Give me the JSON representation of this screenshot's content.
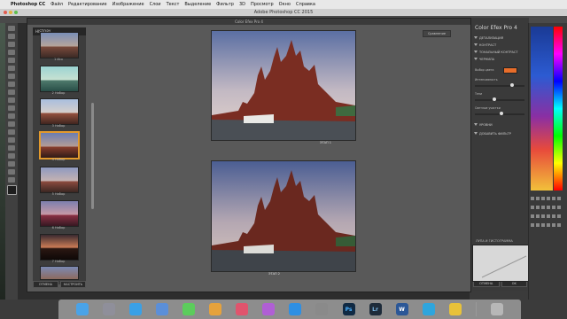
{
  "menubar": {
    "app_name": "Photoshop CC",
    "items": [
      "Файл",
      "Редактирование",
      "Изображение",
      "Слои",
      "Текст",
      "Выделение",
      "Фильтр",
      "3D",
      "Просмотр",
      "Окно",
      "Справка"
    ]
  },
  "window_title": "Adobe Photoshop CC 2015",
  "plugin_title": "Color Efex Pro 4",
  "filmstrip": {
    "header": "HISTORY",
    "captions": [
      "1 Исх",
      "2 Набор",
      "3 Набор",
      "4 Набор",
      "5 Набор",
      "6 Набор",
      "7 Набор",
      "8 Набор"
    ],
    "footer": {
      "left": "ОТМЕНА",
      "right": "НАСТРОИТЬ"
    }
  },
  "preview": {
    "top_button": "Сравнение",
    "top_caption": "ЭТАП 1",
    "bottom_caption": "ЭТАП 2"
  },
  "right_panel": {
    "title_main": "Color Efex Pro",
    "title_version": "4",
    "filter_items": [
      "ДЕТАЛИЗАЦИЯ",
      "КОНТРАСТ",
      "ТОНАЛЬНЫЙ КОНТРАСТ",
      "ЧЕРНИЛА"
    ],
    "controls": {
      "row1_label": "Выбор цвета",
      "row2_label": "Интенсивность",
      "row3_label": "Тени",
      "row4_label": "Светлые участки"
    },
    "sections": [
      "УРОВНИ",
      "ДОБАВИТЬ ФИЛЬТР"
    ],
    "bottom": {
      "ok": "OK",
      "cancel": "ОТМЕНА"
    },
    "loupe_title": "ЛУПА И ГИСТОГРАММА"
  },
  "dock": {
    "apps": [
      "Finder",
      "Launchpad",
      "Safari",
      "Mail",
      "Messages",
      "Photos",
      "Music",
      "iTunes",
      "App Store",
      "Settings",
      "Photoshop",
      "Lightroom",
      "Word",
      "Telegram",
      "Chrome",
      "Trash"
    ]
  },
  "colors": {
    "accent": "#e39a2c",
    "orange_swatch": "#e86d2a"
  }
}
